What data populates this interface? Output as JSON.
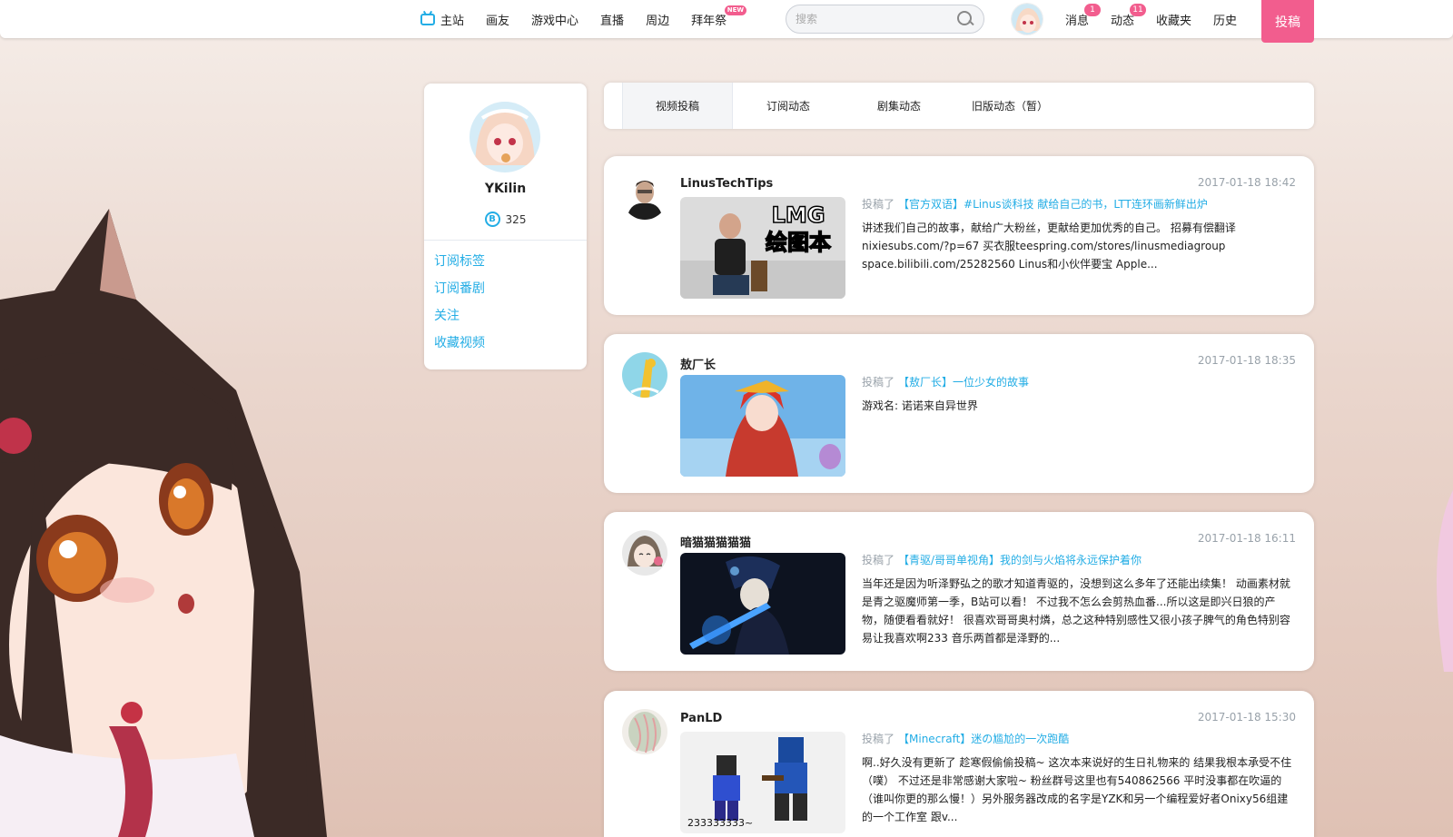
{
  "nav": {
    "items": [
      {
        "label": "主站",
        "icon": "tv-icon"
      },
      {
        "label": "画友"
      },
      {
        "label": "游戏中心"
      },
      {
        "label": "直播"
      },
      {
        "label": "周边"
      },
      {
        "label": "拜年祭",
        "badge": "NEW"
      }
    ],
    "search": {
      "placeholder": "搜索"
    },
    "right": [
      {
        "label": "消息",
        "count": "1"
      },
      {
        "label": "动态",
        "count": "11"
      },
      {
        "label": "收藏夹"
      },
      {
        "label": "历史"
      }
    ],
    "upload_label": "投稿",
    "accent_color": "#f25d8e",
    "link_color": "#23ade5"
  },
  "profile": {
    "name": "YKilin",
    "coin_icon": "B",
    "coins": "325",
    "links": [
      "订阅标签",
      "订阅番剧",
      "关注",
      "收藏视频"
    ]
  },
  "tabs": [
    "视频投稿",
    "订阅动态",
    "剧集动态",
    "旧版动态（暂）"
  ],
  "feed": [
    {
      "author": "LinusTechTips",
      "time": "2017-01-18 18:42",
      "verb": "投稿了",
      "title": "【官方双语】#Linus谈科技 献给自己的书，LTT连环画新鲜出炉",
      "thumb_text": [
        "LMG",
        "绘图本"
      ],
      "desc": "讲述我们自己的故事，献给广大粉丝，更献给更加优秀的自己。 招募有偿翻译 nixiesubs.com/?p=67 买衣服teespring.com/stores/linusmediagroup space.bilibili.com/25282560 Linus和小伙伴要宝 Apple..."
    },
    {
      "author": "敖厂长",
      "time": "2017-01-18 18:35",
      "verb": "投稿了",
      "title": "【敖厂长】一位少女的故事",
      "desc": "游戏名: 诺诺来自异世界"
    },
    {
      "author": "暗猫猫猫猫猫",
      "time": "2017-01-18 16:11",
      "verb": "投稿了",
      "title": "【青驱/哥哥单视角】我的剑与火焰将永远保护着你",
      "desc": "当年还是因为听泽野弘之的歌才知道青驱的，没想到这么多年了还能出续集！ 动画素材就是青之驱魔师第一季，B站可以看！ 不过我不怎么会剪热血番...所以这是即兴日狼的产物，随便看看就好！ 很喜欢哥哥奥村燐，总之这种特别感性又很小孩子脾气的角色特别容易让我喜欢啊233 音乐两首都是泽野的..."
    },
    {
      "author": "PanLD",
      "time": "2017-01-18 15:30",
      "verb": "投稿了",
      "title": "【Minecraft】迷の尴尬的一次跑酷",
      "thumb_text": [
        "233333333~"
      ],
      "desc": "啊..好久没有更新了 趁寒假偷偷投稿~ 这次本来说好的生日礼物来的 结果我根本承受不住（噗） 不过还是非常感谢大家啦~ 粉丝群号这里也有540862566 平时没事都在吹逼的（谁叫你更的那么慢！）另外服务器改成的名字是YZK和另一个编程爱好者Onixy56组建的一个工作室 跟v..."
    }
  ]
}
